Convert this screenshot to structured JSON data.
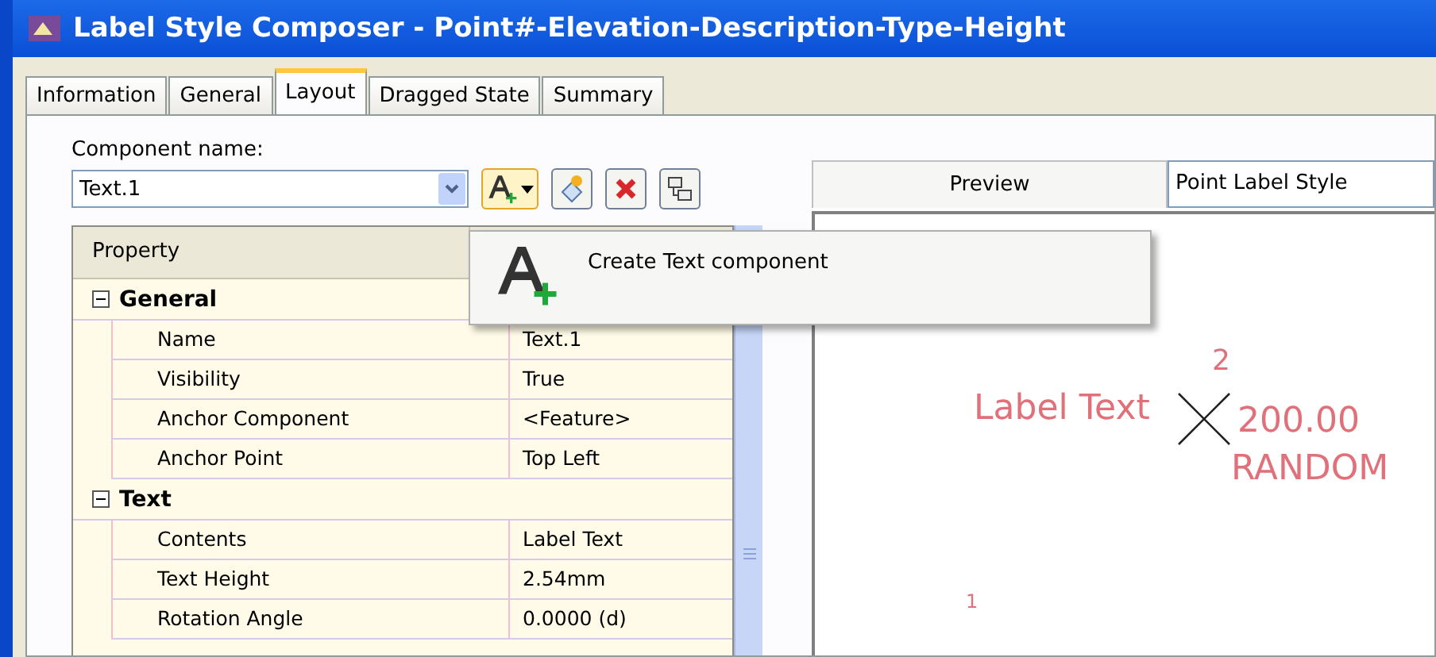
{
  "window": {
    "title": "Label Style Composer - Point#-Elevation-Description-Type-Height"
  },
  "tabs": [
    {
      "label": "Information",
      "selected": false
    },
    {
      "label": "General",
      "selected": false
    },
    {
      "label": "Layout",
      "selected": true
    },
    {
      "label": "Dragged State",
      "selected": false
    },
    {
      "label": "Summary",
      "selected": false
    }
  ],
  "component": {
    "label": "Component name:",
    "value": "Text.1"
  },
  "popup": {
    "label": "Create Text component"
  },
  "grid": {
    "columns": [
      "Property"
    ],
    "groups": [
      {
        "name": "General",
        "expanded": true,
        "rows": [
          {
            "property": "Name",
            "value": "Text.1"
          },
          {
            "property": "Visibility",
            "value": "True"
          },
          {
            "property": "Anchor Component",
            "value": "<Feature>"
          },
          {
            "property": "Anchor Point",
            "value": "Top Left"
          }
        ]
      },
      {
        "name": "Text",
        "expanded": true,
        "rows": [
          {
            "property": "Contents",
            "value": "Label Text"
          },
          {
            "property": "Text Height",
            "value": "2.54mm"
          },
          {
            "property": "Rotation Angle",
            "value": "0.0000 (d)"
          }
        ]
      }
    ]
  },
  "preview": {
    "label": "Preview",
    "style": "Point Label Style",
    "texts": [
      "Label Text",
      "2",
      "200.00",
      "RANDOM",
      "1"
    ]
  }
}
